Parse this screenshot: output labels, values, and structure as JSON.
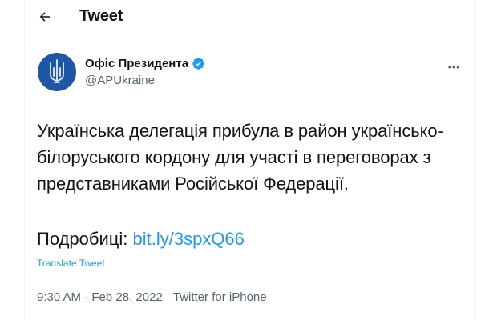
{
  "header": {
    "back_icon": "arrow-left-icon",
    "title": "Tweet"
  },
  "author": {
    "avatar_icon": "trident-emblem-icon",
    "display_name": "Офіс Президента",
    "verified_icon": "verified-badge-icon",
    "handle": "@APUkraine",
    "more_icon": "more-horizontal-icon"
  },
  "tweet": {
    "text_lines": [
      "Українська делегація прибула в район українсько-",
      "білоруського кордону для участі в переговорах з",
      "представниками Російської Федерації."
    ],
    "more_prefix": "Подробиці:",
    "link": "bit.ly/3spxQ66",
    "translate": "Translate Tweet",
    "time": "9:30 AM",
    "separator": "·",
    "date": "Feb 28, 2022",
    "source": "Twitter for iPhone"
  },
  "colors": {
    "accent": "#1d9bf0",
    "text": "#0f1419",
    "secondary": "#536471",
    "avatar_bg": "#1f57a6"
  }
}
